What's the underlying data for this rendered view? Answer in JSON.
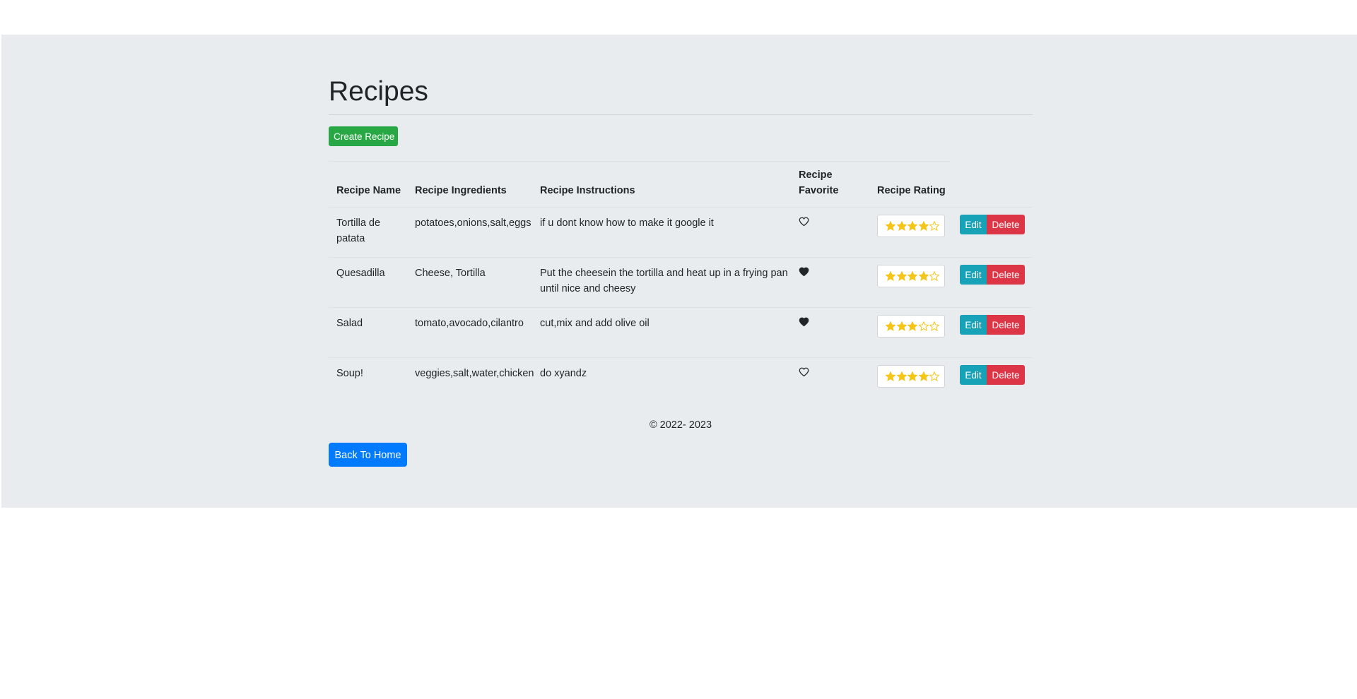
{
  "page": {
    "title": "Recipes",
    "create_button": "Create Recipe",
    "footer": "© 2022- 2023",
    "back_button": "Back To Home"
  },
  "colors": {
    "background": "#e9ecef",
    "create": "#28a745",
    "edit": "#17a2b8",
    "delete": "#dc3545",
    "home": "#007bff",
    "star": "#f5c518"
  },
  "table": {
    "headers": {
      "name": "Recipe Name",
      "ingredients": "Recipe Ingredients",
      "instructions": "Recipe Instructions",
      "favorite": "Recipe Favorite",
      "rating": "Recipe Rating"
    },
    "edit_label": "Edit",
    "delete_label": "Delete",
    "rows": [
      {
        "name": "Tortilla de patata",
        "ingredients": "potatoes,onions,salt,eggs",
        "instructions": "if u dont know how to make it google it",
        "favorite": false,
        "rating": 4
      },
      {
        "name": "Quesadilla",
        "ingredients": "Cheese, Tortilla",
        "instructions": "Put the cheesein the tortilla and heat up in a frying pan until nice and cheesy",
        "favorite": true,
        "rating": 4
      },
      {
        "name": "Salad",
        "ingredients": "tomato,avocado,cilantro",
        "instructions": "cut,mix and add olive oil",
        "favorite": true,
        "rating": 3
      },
      {
        "name": "Soup!",
        "ingredients": "veggies,salt,water,chicken",
        "instructions": "do xyandz",
        "favorite": false,
        "rating": 4
      }
    ]
  }
}
